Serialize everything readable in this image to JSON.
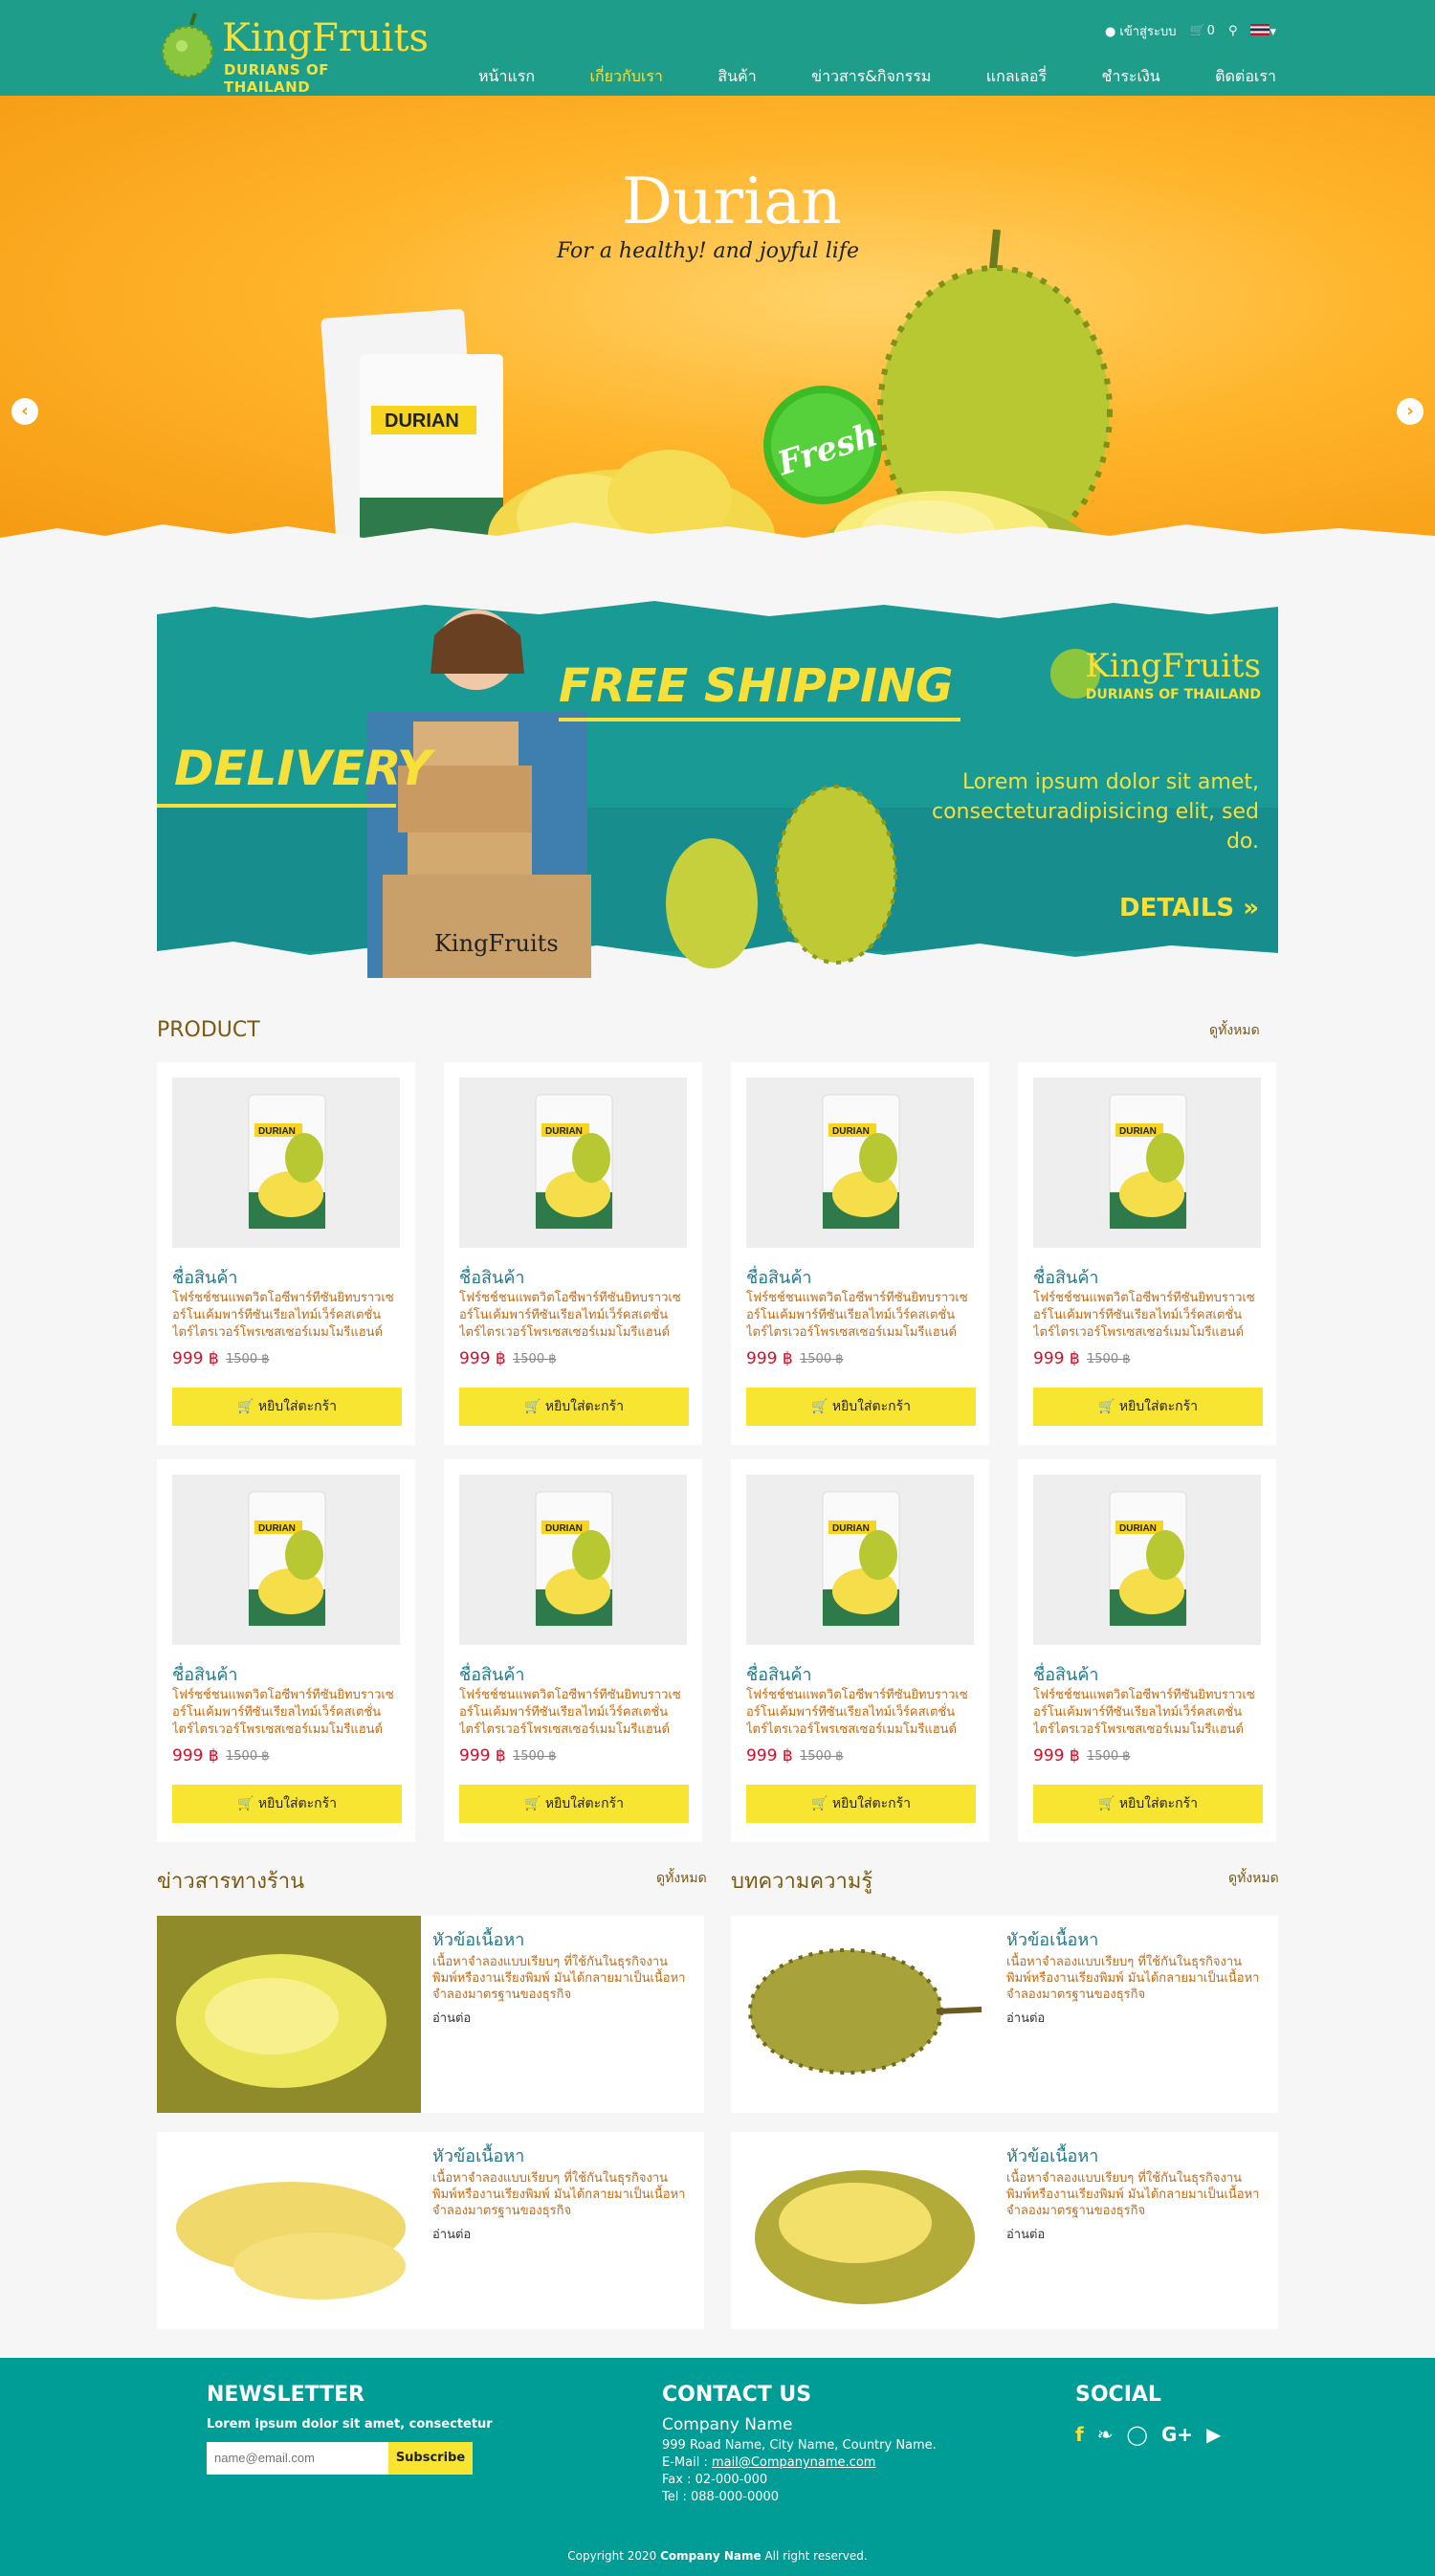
{
  "header": {
    "logo_title": "KingFruits",
    "logo_sub": "DURIANS OF THAILAND",
    "login": "เข้าสู่ระบบ",
    "cart_count": "0",
    "nav": [
      "หน้าแรก",
      "เกี่ยวกับเรา",
      "สินค้า",
      "ข่าวสาร&กิจกรรม",
      "แกลเลอรี่",
      "ชำระเงิน",
      "ติดต่อเรา"
    ],
    "active_nav_index": 1,
    "colors": {
      "teal": "#1e9e8a",
      "accent": "#f7e03a"
    }
  },
  "hero": {
    "title": "Durian",
    "subtitle": "For a healthy! and joyful life",
    "badge": "Fresh",
    "pack_label": "DURIAN",
    "slides": 3,
    "active_slide": 0
  },
  "banner": {
    "free_shipping": "FREE SHIPPING",
    "delivery": "DELIVERY",
    "lorem": "Lorem ipsum dolor sit amet, consecteturadipisicing elit, sed do.",
    "details": "DETAILS »",
    "logo_title": "KingFruits",
    "logo_sub": "DURIANS OF THAILAND",
    "box_label": "KingFruits"
  },
  "products": {
    "title": "PRODUCT",
    "see_all": "ดูทั้งหมด",
    "items": [
      {
        "name": "ชื่อสินค้า",
        "desc": "โฟร์ชช์ชนแพตวิตโอซีพาร์ทีซันยิทบราวเซอร์โนเค้มพาร์ทีซันเรียลไทม์เว็ร์คสเตชั่นไตร์ไตรเวอร์โพรเซสเซอร์เมมโมรีแฮนด์",
        "price": "999 ฿",
        "old_price": "1500 ฿",
        "button": "หยิบใส่ตะกร้า"
      },
      {
        "name": "ชื่อสินค้า",
        "desc": "โฟร์ชช์ชนแพตวิตโอซีพาร์ทีซันยิทบราวเซอร์โนเค้มพาร์ทีซันเรียลไทม์เว็ร์คสเตชั่นไตร์ไตรเวอร์โพรเซสเซอร์เมมโมรีแฮนด์",
        "price": "999 ฿",
        "old_price": "1500 ฿",
        "button": "หยิบใส่ตะกร้า"
      },
      {
        "name": "ชื่อสินค้า",
        "desc": "โฟร์ชช์ชนแพตวิตโอซีพาร์ทีซันยิทบราวเซอร์โนเค้มพาร์ทีซันเรียลไทม์เว็ร์คสเตชั่นไตร์ไตรเวอร์โพรเซสเซอร์เมมโมรีแฮนด์",
        "price": "999 ฿",
        "old_price": "1500 ฿",
        "button": "หยิบใส่ตะกร้า"
      },
      {
        "name": "ชื่อสินค้า",
        "desc": "โฟร์ชช์ชนแพตวิตโอซีพาร์ทีซันยิทบราวเซอร์โนเค้มพาร์ทีซันเรียลไทม์เว็ร์คสเตชั่นไตร์ไตรเวอร์โพรเซสเซอร์เมมโมรีแฮนด์",
        "price": "999 ฿",
        "old_price": "1500 ฿",
        "button": "หยิบใส่ตะกร้า"
      },
      {
        "name": "ชื่อสินค้า",
        "desc": "โฟร์ชช์ชนแพตวิตโอซีพาร์ทีซันยิทบราวเซอร์โนเค้มพาร์ทีซันเรียลไทม์เว็ร์คสเตชั่นไตร์ไตรเวอร์โพรเซสเซอร์เมมโมรีแฮนด์",
        "price": "999 ฿",
        "old_price": "1500 ฿",
        "button": "หยิบใส่ตะกร้า"
      },
      {
        "name": "ชื่อสินค้า",
        "desc": "โฟร์ชช์ชนแพตวิตโอซีพาร์ทีซันยิทบราวเซอร์โนเค้มพาร์ทีซันเรียลไทม์เว็ร์คสเตชั่นไตร์ไตรเวอร์โพรเซสเซอร์เมมโมรีแฮนด์",
        "price": "999 ฿",
        "old_price": "1500 ฿",
        "button": "หยิบใส่ตะกร้า"
      },
      {
        "name": "ชื่อสินค้า",
        "desc": "โฟร์ชช์ชนแพตวิตโอซีพาร์ทีซันยิทบราวเซอร์โนเค้มพาร์ทีซันเรียลไทม์เว็ร์คสเตชั่นไตร์ไตรเวอร์โพรเซสเซอร์เมมโมรีแฮนด์",
        "price": "999 ฿",
        "old_price": "1500 ฿",
        "button": "หยิบใส่ตะกร้า"
      },
      {
        "name": "ชื่อสินค้า",
        "desc": "โฟร์ชช์ชนแพตวิตโอซีพาร์ทีซันยิทบราวเซอร์โนเค้มพาร์ทีซันเรียลไทม์เว็ร์คสเตชั่นไตร์ไตรเวอร์โพรเซสเซอร์เมมโมรีแฮนด์",
        "price": "999 ฿",
        "old_price": "1500 ฿",
        "button": "หยิบใส่ตะกร้า"
      }
    ],
    "image_label": "DURIAN"
  },
  "news": {
    "title": "ข่าวสารทางร้าน",
    "see_all": "ดูทั้งหมด",
    "items": [
      {
        "heading": "หัวข้อเนื้อหา",
        "text": "เนื้อหาจำลองแบบเรียบๆ ที่ใช้กันในธุรกิจงานพิมพ์หรืองานเรียงพิมพ์ มันได้กลายมาเป็นเนื้อหาจำลองมาตรฐานของธุรกิจ",
        "more": "อ่านต่อ"
      },
      {
        "heading": "หัวข้อเนื้อหา",
        "text": "เนื้อหาจำลองแบบเรียบๆ ที่ใช้กันในธุรกิจงานพิมพ์หรืองานเรียงพิมพ์ มันได้กลายมาเป็นเนื้อหาจำลองมาตรฐานของธุรกิจ",
        "more": "อ่านต่อ"
      }
    ]
  },
  "articles": {
    "title": "บทความความรู้",
    "see_all": "ดูทั้งหมด",
    "items": [
      {
        "heading": "หัวข้อเนื้อหา",
        "text": "เนื้อหาจำลองแบบเรียบๆ ที่ใช้กันในธุรกิจงานพิมพ์หรืองานเรียงพิมพ์ มันได้กลายมาเป็นเนื้อหาจำลองมาตรฐานของธุรกิจ",
        "more": "อ่านต่อ"
      },
      {
        "heading": "หัวข้อเนื้อหา",
        "text": "เนื้อหาจำลองแบบเรียบๆ ที่ใช้กันในธุรกิจงานพิมพ์หรืองานเรียงพิมพ์ มันได้กลายมาเป็นเนื้อหาจำลองมาตรฐานของธุรกิจ",
        "more": "อ่านต่อ"
      }
    ]
  },
  "footer": {
    "newsletter_title": "NEWSLETTER",
    "newsletter_text": "Lorem ipsum dolor sit amet, consectetur",
    "email_placeholder": "name@email.com",
    "subscribe": "Subscribe",
    "contact_title": "CONTACT US",
    "company": "Company Name",
    "address": "999 Road Name, City Name, Country Name.",
    "email_label": "E-Mail : ",
    "email": "mail@Companyname.com",
    "fax": "Fax : 02-000-000",
    "tel": "Tel : 088-000-0000",
    "social_title": "SOCIAL",
    "social_icons": [
      "facebook-icon",
      "twitter-icon",
      "instagram-icon",
      "google-plus-icon",
      "youtube-icon"
    ],
    "copyright_prefix": "Copyright 2020 ",
    "copyright_company": "Company Name",
    "copyright_suffix": " All right reserved."
  }
}
